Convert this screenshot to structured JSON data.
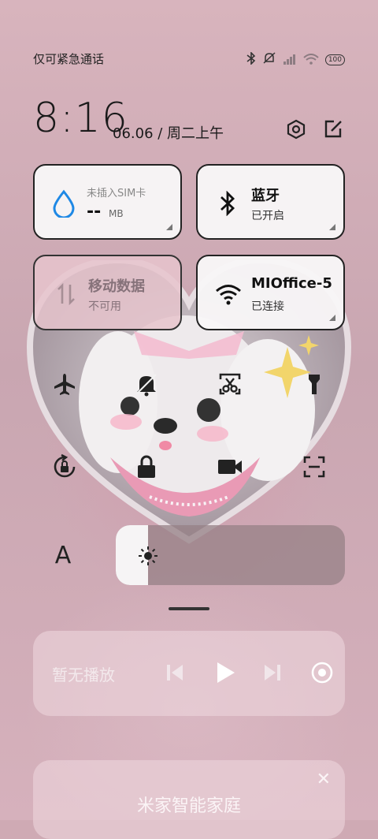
{
  "status_bar": {
    "carrier_text": "仅可紧急通话",
    "battery": "100",
    "icons": [
      "bluetooth-icon",
      "mute-icon",
      "signal-icon",
      "wifi-icon",
      "battery-icon"
    ]
  },
  "header": {
    "time": "8:16",
    "date": "06.06 / 周二上午",
    "icons": [
      "settings-icon",
      "edit-icon"
    ]
  },
  "tiles": {
    "data_usage": {
      "title": "未插入SIM卡",
      "value": "--",
      "unit": "MB"
    },
    "bluetooth": {
      "title": "蓝牙",
      "status": "已开启"
    },
    "mobile_data": {
      "title": "移动数据",
      "status": "不可用"
    },
    "wifi": {
      "title": "MIOffice-5",
      "status": "已连接"
    }
  },
  "quick_settings": {
    "row1": [
      "airplane-mode-icon",
      "mute-icon",
      "screenshot-icon",
      "flashlight-icon"
    ],
    "row2": [
      "rotation-lock-icon",
      "lock-screen-icon",
      "screen-record-icon",
      "scan-icon"
    ]
  },
  "brightness": {
    "auto_label": "A",
    "level": 0.14
  },
  "media": {
    "status": "暂无播放"
  },
  "smart_home": {
    "title": "米家智能家庭",
    "close": "✕"
  },
  "colors": {
    "accent_blue": "#1e88e5",
    "tile_bg": "#f8f6f7",
    "background": "#cfaab4"
  }
}
